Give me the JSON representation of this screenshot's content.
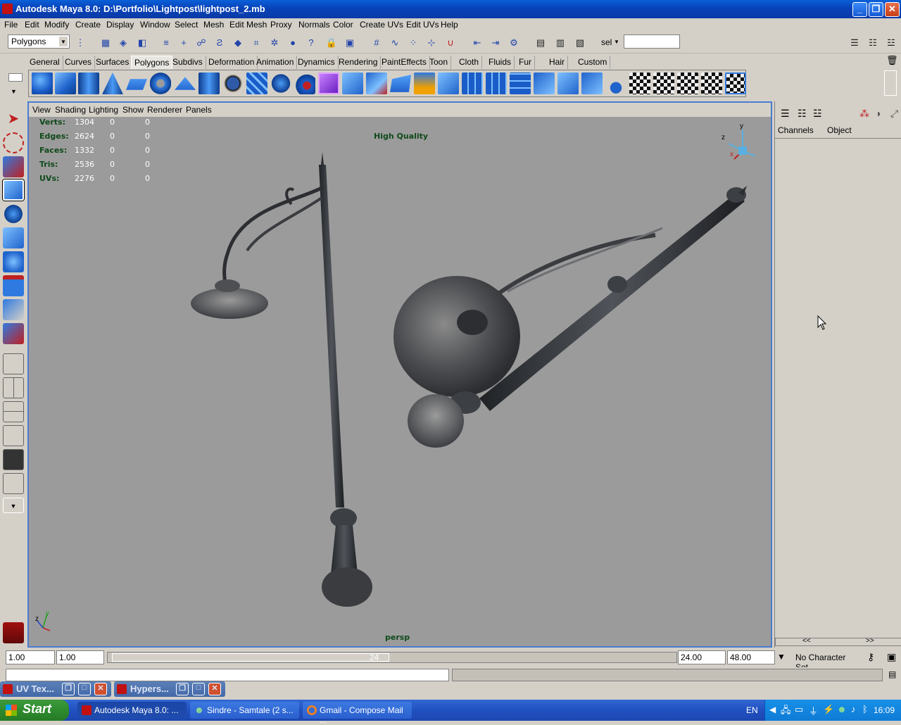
{
  "window": {
    "title": "Autodesk Maya 8.0: D:\\Portfolio\\Lightpost\\lightpost_2.mb"
  },
  "menu": [
    "File",
    "Edit",
    "Modify",
    "Create",
    "Display",
    "Window",
    "Select",
    "Mesh",
    "Edit Mesh",
    "Proxy",
    "Normals",
    "Color",
    "Create UVs",
    "Edit UVs",
    "Help"
  ],
  "status_line": {
    "menu_set": "Polygons",
    "sel_label": "sel",
    "sel_value": ""
  },
  "shelf_tabs": [
    "General",
    "Curves",
    "Surfaces",
    "Polygons",
    "Subdivs",
    "Deformation",
    "Animation",
    "Dynamics",
    "Rendering",
    "PaintEffects",
    "Toon",
    "Cloth",
    "Fluids",
    "Fur",
    "Hair",
    "Custom"
  ],
  "active_tab": "Polygons",
  "panel_menu": [
    "View",
    "Shading",
    "Lighting",
    "Show",
    "Renderer",
    "Panels"
  ],
  "hud": {
    "rows": [
      {
        "label": "Verts:",
        "v1": "1304",
        "v2": "0",
        "v3": "0"
      },
      {
        "label": "Edges:",
        "v1": "2624",
        "v2": "0",
        "v3": "0"
      },
      {
        "label": "Faces:",
        "v1": "1332",
        "v2": "0",
        "v3": "0"
      },
      {
        "label": "Tris:",
        "v1": "2536",
        "v2": "0",
        "v3": "0"
      },
      {
        "label": "UVs:",
        "v1": "2276",
        "v2": "0",
        "v3": "0"
      }
    ],
    "quality": "High Quality",
    "camera": "persp",
    "axis_labels": {
      "x": "x",
      "y": "y",
      "z": "z"
    }
  },
  "channel_box": {
    "tabs": [
      "Channels",
      "Object"
    ],
    "scroll_left": "<<",
    "scroll_right": ">>"
  },
  "timeline": {
    "start_outer": "1.00",
    "start_inner": "1.00",
    "end_inner": "24.00",
    "end_outer": "48.00",
    "slider_end": "24",
    "character_set": "No Character Set"
  },
  "minimized": [
    {
      "label": "UV Tex..."
    },
    {
      "label": "Hypers..."
    }
  ],
  "taskbar": {
    "start": "Start",
    "tasks": [
      "Autodesk Maya 8.0: ...",
      "Sindre - Samtale (2 s...",
      "Gmail - Compose Mail ..."
    ],
    "lang": "EN",
    "clock": "16:09"
  },
  "colors": {
    "title_blue": "#0a5fd8",
    "viewport_bg": "#9b9b9b",
    "hud_green": "#0f4a1a",
    "viewport_border": "#4a7bd0"
  }
}
